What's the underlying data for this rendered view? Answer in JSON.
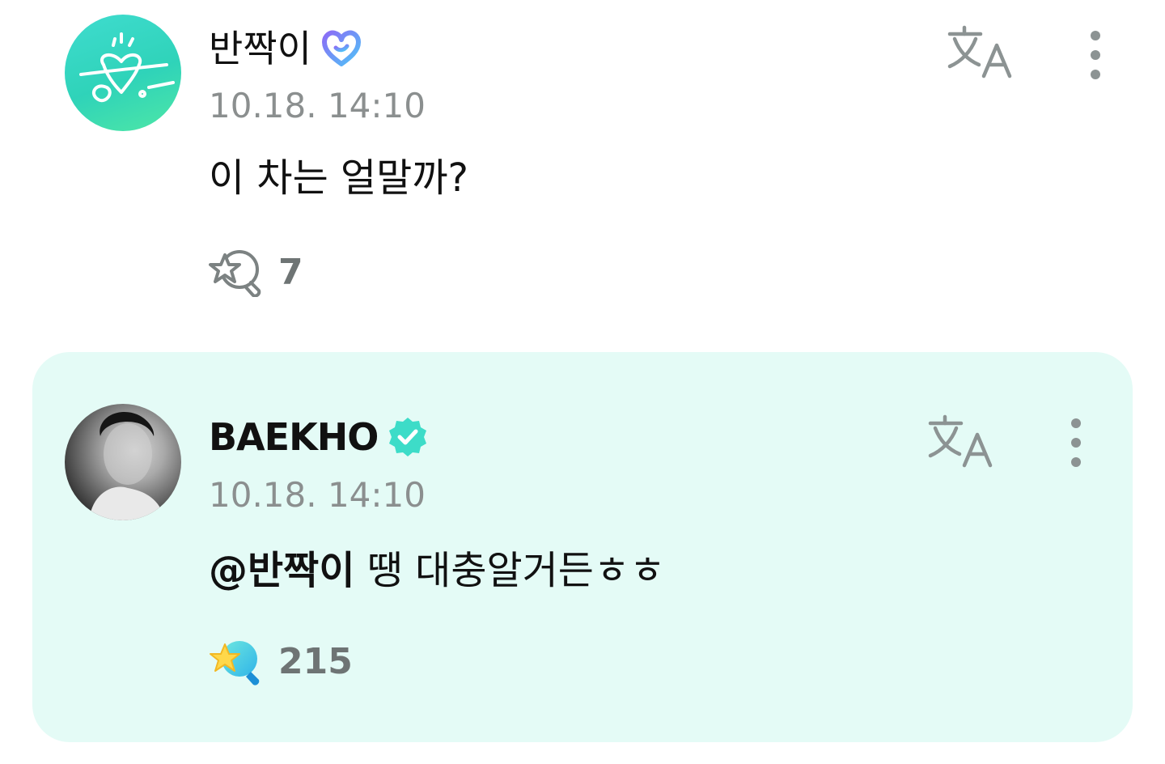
{
  "comments": [
    {
      "author": "반짝이",
      "author_badge_icon": "fan-heart-badge-icon",
      "timestamp": "10.18. 14:10",
      "body": "이 차는 얼말까?",
      "reaction_icon": "star-magnifier-outline-icon",
      "reaction_count": "7"
    },
    {
      "author": "BAEKHO",
      "author_badge_icon": "verified-check-badge-icon",
      "timestamp": "10.18. 14:10",
      "mention": "@반짝이",
      "body": " 땡 대충알거든ㅎㅎ",
      "reaction_icon": "star-magnifier-filled-icon",
      "reaction_count": "215"
    }
  ],
  "colors": {
    "highlight_bg": "#e4fbf6",
    "accent_teal": "#3ddcc8",
    "timestamp_gray": "#8b8f8f"
  }
}
